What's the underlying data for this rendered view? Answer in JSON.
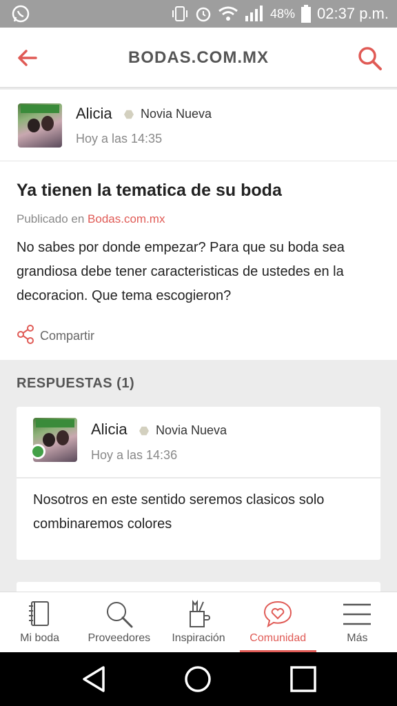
{
  "status_bar": {
    "battery": "48%",
    "time": "02:37 p.m."
  },
  "app_bar": {
    "title": "BODAS.COM.MX"
  },
  "post": {
    "author": {
      "name": "Alicia",
      "badge": "Novia Nueva",
      "time": "Hoy a las 14:35"
    },
    "title": "Ya tienen la tematica de su boda",
    "published_prefix": "Publicado en",
    "published_site": "Bodas.com.mx",
    "body": "No sabes por donde empezar? Para que su boda sea grandiosa debe tener caracteristicas de ustedes en la decoracion. Que tema escogieron?",
    "share_label": "Compartir"
  },
  "responses": {
    "title": "RESPUESTAS (1)",
    "items": [
      {
        "author": {
          "name": "Alicia",
          "badge": "Novia Nueva",
          "time": "Hoy a las 14:36"
        },
        "text": "Nosotros en este sentido seremos clasicos solo combinaremos colores"
      }
    ]
  },
  "bottom_nav": [
    {
      "label": "Mi boda",
      "icon": "notebook-icon",
      "active": false
    },
    {
      "label": "Proveedores",
      "icon": "search-icon",
      "active": false
    },
    {
      "label": "Inspiración",
      "icon": "pencil-cup-icon",
      "active": false
    },
    {
      "label": "Comunidad",
      "icon": "heart-chat-icon",
      "active": true
    },
    {
      "label": "Más",
      "icon": "menu-icon",
      "active": false
    }
  ],
  "colors": {
    "accent": "#e05a55",
    "online": "#43a047",
    "badge": "#d3d0bf"
  }
}
